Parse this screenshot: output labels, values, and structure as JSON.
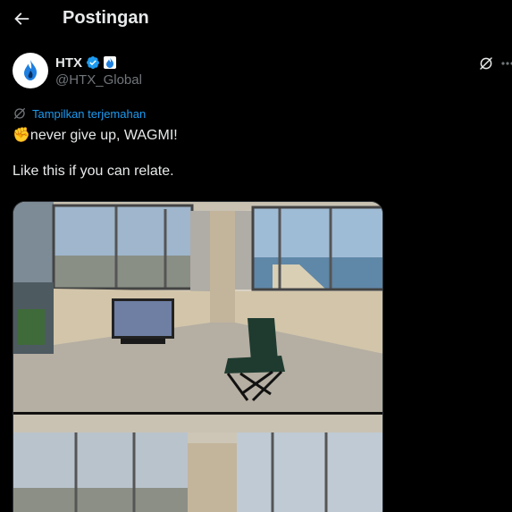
{
  "header": {
    "back_icon": "arrow-left-icon",
    "title": "Postingan"
  },
  "author": {
    "display_name": "HTX",
    "handle": "@HTX_Global",
    "verified_icon": "verified-badge-icon",
    "affiliate_icon": "htx-affiliate-badge-icon",
    "avatar_icon": "htx-flame-logo"
  },
  "actions": {
    "grok_icon": "grok-icon",
    "more_icon": "more-dots-icon"
  },
  "translate": {
    "label": "Tampilkan terjemahan",
    "icon": "translate-globe-icon"
  },
  "tweet": {
    "text": "✊never give up, WAGMI!\n\nLike this if you can relate."
  },
  "colors": {
    "background": "#000000",
    "text": "#e7e9ea",
    "muted": "#71767b",
    "link": "#1d9bf0",
    "brand": "#1d9bf0"
  }
}
